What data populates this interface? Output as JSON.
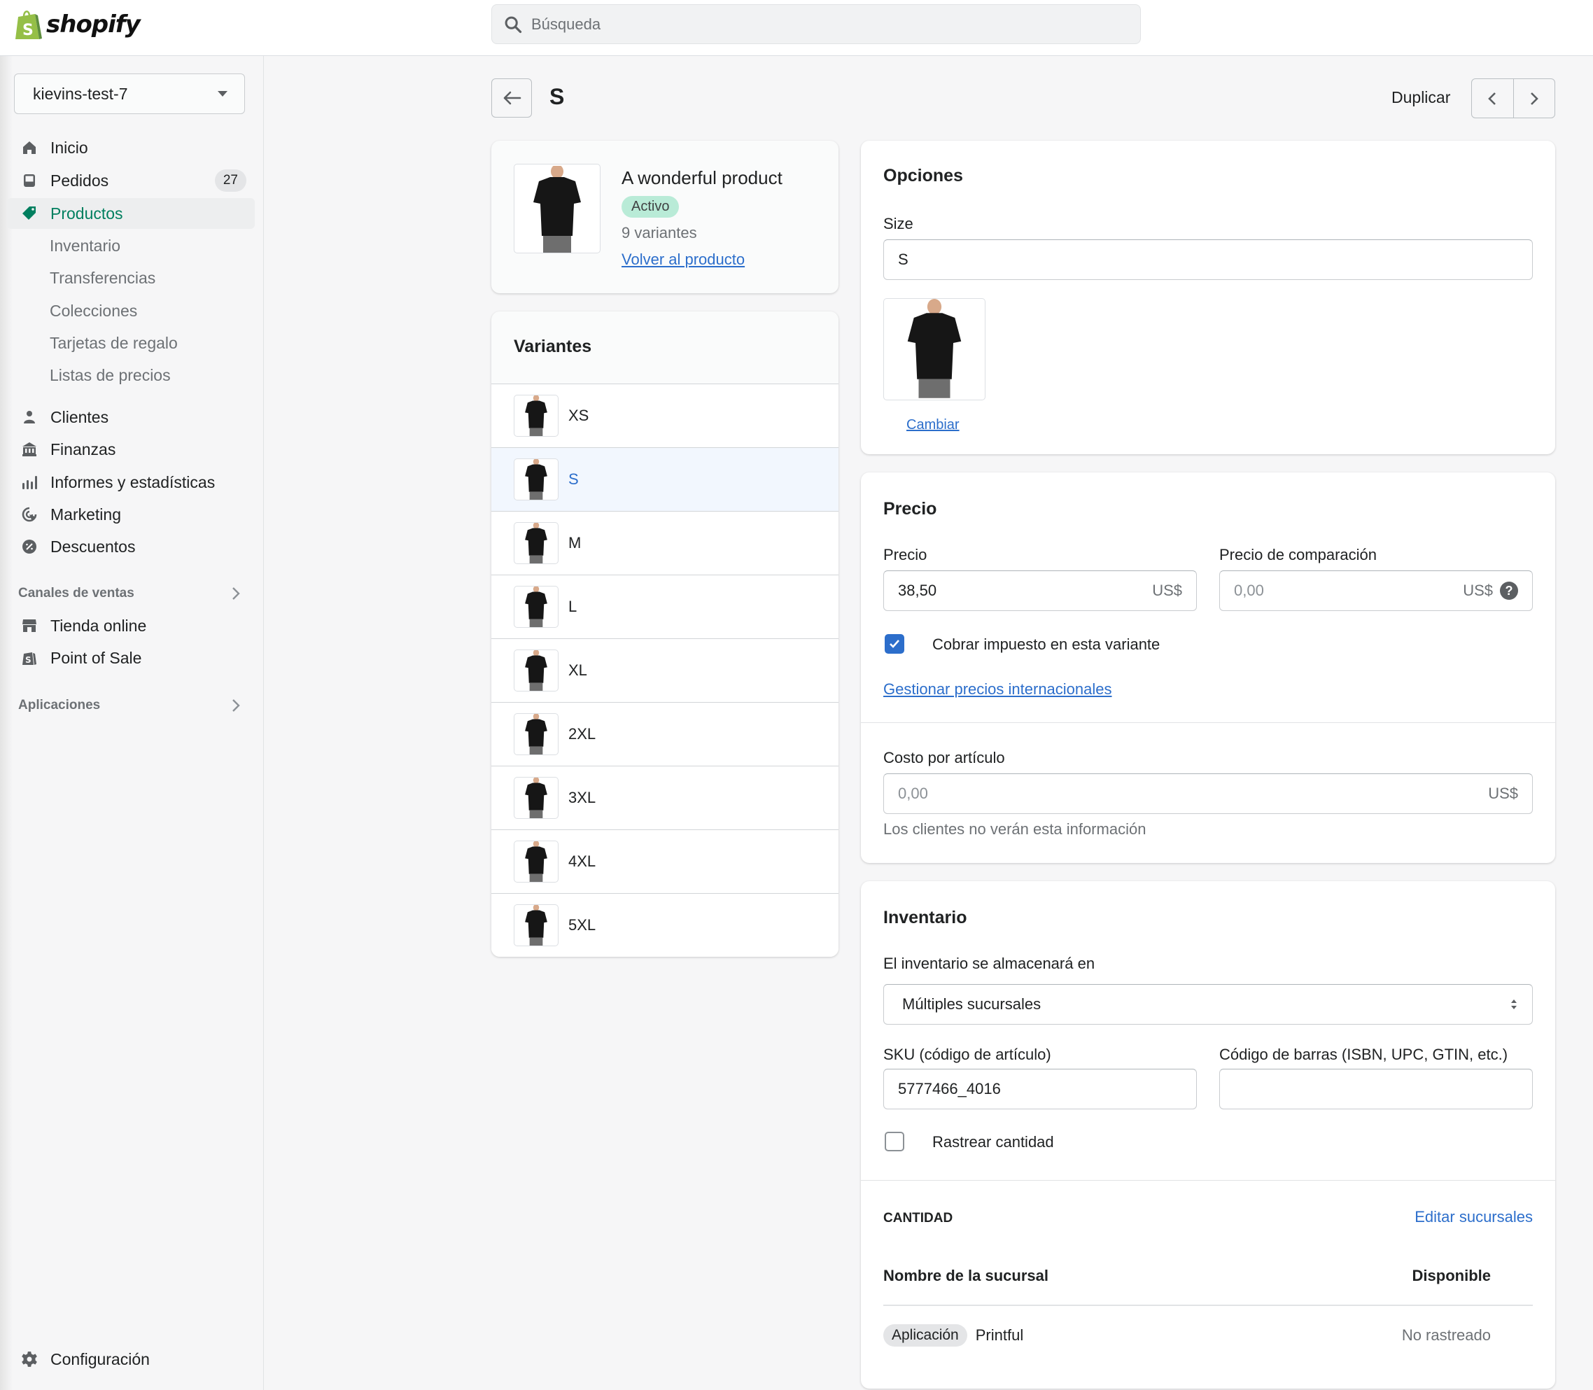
{
  "app": {
    "brand": "shopify"
  },
  "search": {
    "placeholder": "Búsqueda"
  },
  "store": {
    "name": "kievins-test-7"
  },
  "sidebar": {
    "items": [
      {
        "label": "Inicio",
        "icon": "home-icon"
      },
      {
        "label": "Pedidos",
        "icon": "orders-icon",
        "badge": "27"
      },
      {
        "label": "Productos",
        "icon": "tag-icon",
        "active": true
      },
      {
        "label": "Inventario",
        "sub": true
      },
      {
        "label": "Transferencias",
        "sub": true
      },
      {
        "label": "Colecciones",
        "sub": true
      },
      {
        "label": "Tarjetas de regalo",
        "sub": true
      },
      {
        "label": "Listas de precios",
        "sub": true
      },
      {
        "label": "Clientes",
        "icon": "person-icon"
      },
      {
        "label": "Finanzas",
        "icon": "bank-icon"
      },
      {
        "label": "Informes y estadísticas",
        "icon": "bar-chart-icon"
      },
      {
        "label": "Marketing",
        "icon": "target-icon"
      },
      {
        "label": "Descuentos",
        "icon": "discount-icon"
      }
    ],
    "sales_channels": {
      "heading": "Canales de ventas",
      "items": [
        {
          "label": "Tienda online",
          "icon": "store-icon"
        },
        {
          "label": "Point of Sale",
          "icon": "pos-icon"
        }
      ]
    },
    "apps": {
      "heading": "Aplicaciones"
    },
    "settings": {
      "label": "Configuración"
    }
  },
  "page": {
    "title": "S",
    "duplicate_label": "Duplicar"
  },
  "product": {
    "name": "A wonderful product",
    "status": "Activo",
    "variant_count": "9 variantes",
    "back_link": "Volver al producto"
  },
  "variants": {
    "title": "Variantes",
    "items": [
      "XS",
      "S",
      "M",
      "L",
      "XL",
      "2XL",
      "3XL",
      "4XL",
      "5XL"
    ],
    "selected": "S"
  },
  "options": {
    "title": "Opciones",
    "size_label": "Size",
    "size_value": "S",
    "change_image": "Cambiar"
  },
  "pricing": {
    "title": "Precio",
    "price_label": "Precio",
    "price_value": "38,50",
    "currency": "US$",
    "compare_label": "Precio de comparación",
    "compare_placeholder": "0,00",
    "charge_tax_label": "Cobrar impuesto en esta variante",
    "charge_tax": true,
    "intl_link": "Gestionar precios internacionales",
    "cost_label": "Costo por artículo",
    "cost_placeholder": "0,00",
    "cost_help": "Los clientes no verán esta información"
  },
  "inventory": {
    "title": "Inventario",
    "stored_label": "El inventario se almacenará en",
    "stored_value": "Múltiples sucursales",
    "sku_label": "SKU (código de artículo)",
    "sku_value": "5777466_4016",
    "barcode_label": "Código de barras (ISBN, UPC, GTIN, etc.)",
    "barcode_value": "",
    "track_label": "Rastrear cantidad",
    "track": false,
    "quantity_heading": "CANTIDAD",
    "edit_locations": "Editar sucursales",
    "col_location": "Nombre de la sucursal",
    "col_available": "Disponible",
    "rows": [
      {
        "tag": "Aplicación",
        "name": "Printful",
        "available": "No rastreado"
      }
    ]
  },
  "colors": {
    "accent": "#2c6ecb",
    "active_nav": "#007f5f",
    "status_badge": "#aee9d1"
  }
}
